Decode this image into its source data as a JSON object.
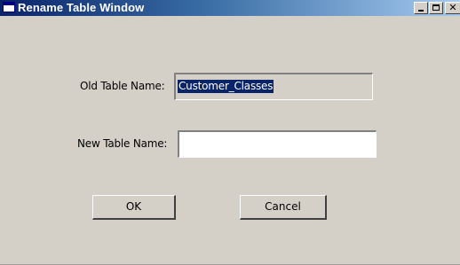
{
  "window": {
    "title": "Rename Table Window"
  },
  "form": {
    "old_table_label": "Old Table Name:",
    "old_table_value": "Customer_Classes",
    "new_table_label": "New Table Name:",
    "new_table_value": ""
  },
  "buttons": {
    "ok_label": "OK",
    "cancel_label": "Cancel"
  },
  "icons": {
    "app": "window-icon",
    "minimize": "minimize-icon",
    "maximize": "maximize-icon",
    "close": "close-icon"
  },
  "colors": {
    "title_start": "#0a246a",
    "title_end": "#a6caf0",
    "face": "#d4d0c8",
    "selection": "#0a246a"
  }
}
